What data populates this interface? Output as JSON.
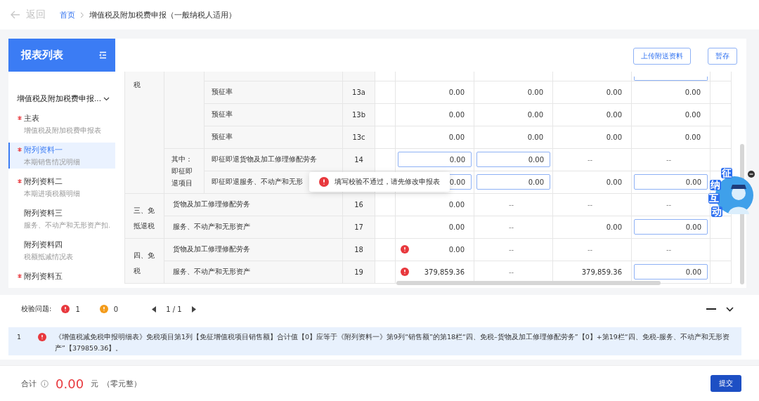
{
  "topbar": {
    "back": "返回",
    "breadcrumb": [
      {
        "label": "首页",
        "kind": "link"
      },
      {
        "label": "增值税及附加税费申报（一般纳税人适用）",
        "kind": "current"
      }
    ]
  },
  "sidebar": {
    "title": "报表列表",
    "group": {
      "label": "增值税及附加税费申报...",
      "expanded": true
    },
    "items": [
      {
        "title": "主表",
        "subtitle": "增值税及附加税费申报表",
        "required": true,
        "selected": false
      },
      {
        "title": "附列资料一",
        "subtitle": "本期销售情况明细",
        "required": true,
        "selected": true
      },
      {
        "title": "附列资料二",
        "subtitle": "本期进项税额明细",
        "required": true,
        "selected": false
      },
      {
        "title": "附列资料三",
        "subtitle": "服务、不动产和无形资产扣.",
        "required": false,
        "selected": false
      },
      {
        "title": "附列资料四",
        "subtitle": "税额抵减情况表",
        "required": false,
        "selected": false
      },
      {
        "title": "附列资料五",
        "required": true,
        "selected": false
      }
    ]
  },
  "actions": [
    "上传附送资料",
    "暂存"
  ],
  "table": {
    "groups": [
      {
        "label": "税",
        "subgroups": [
          {
            "rows": [
              {
                "cells": [
                  {
                    "kind": "blank"
                  },
                  {
                    "kind": "blank"
                  },
                  {
                    "kind": "blank"
                  },
                  {
                    "kind": "input"
                  }
                ]
              },
              {
                "label": "预征率",
                "line": "13a",
                "cells": [
                  {
                    "kind": "text",
                    "value": "0.00"
                  },
                  {
                    "kind": "text",
                    "value": "0.00"
                  },
                  {
                    "kind": "text",
                    "value": "0.00"
                  },
                  {
                    "kind": "text",
                    "value": "0.00"
                  }
                ]
              },
              {
                "label": "预征率",
                "line": "13b",
                "cells": [
                  {
                    "kind": "text",
                    "value": "0.00"
                  },
                  {
                    "kind": "text",
                    "value": "0.00"
                  },
                  {
                    "kind": "text",
                    "value": "0.00"
                  },
                  {
                    "kind": "text",
                    "value": "0.00"
                  }
                ]
              },
              {
                "label": "预征率",
                "line": "13c",
                "cells": [
                  {
                    "kind": "text",
                    "value": "0.00"
                  },
                  {
                    "kind": "text",
                    "value": "0.00"
                  },
                  {
                    "kind": "text",
                    "value": "0.00"
                  },
                  {
                    "kind": "text",
                    "value": "0.00"
                  }
                ]
              }
            ]
          },
          {
            "label": "其中：即征即退项目",
            "rows": [
              {
                "label": "即征即退货物及加工修理修配劳务",
                "line": "14",
                "cells": [
                  {
                    "kind": "input",
                    "value": "0.00"
                  },
                  {
                    "kind": "input",
                    "value": "0.00"
                  },
                  {
                    "kind": "text",
                    "value": "--"
                  },
                  {
                    "kind": "text",
                    "value": "--"
                  }
                ]
              },
              {
                "label": "即征即退服务、不动产和无形",
                "cells": [
                  {
                    "kind": "input",
                    "value": "0.00"
                  },
                  {
                    "kind": "input",
                    "value": "0.00"
                  },
                  {
                    "kind": "text",
                    "value": "0.00"
                  },
                  {
                    "kind": "input",
                    "value": "0.00"
                  }
                ]
              }
            ]
          }
        ]
      },
      {
        "label": "三、免抵退税",
        "rows": [
          {
            "label": "货物及加工修理修配劳务",
            "line": "16",
            "cells": [
              {
                "kind": "text",
                "value": "0.00"
              },
              {
                "kind": "text",
                "value": "--"
              },
              {
                "kind": "text",
                "value": "--"
              },
              {
                "kind": "text",
                "value": "--"
              }
            ]
          },
          {
            "label": "服务、不动产和无形资产",
            "line": "17",
            "cells": [
              {
                "kind": "text",
                "value": "0.00"
              },
              {
                "kind": "text",
                "value": "--"
              },
              {
                "kind": "text",
                "value": "0.00"
              },
              {
                "kind": "input",
                "value": "0.00"
              }
            ]
          }
        ]
      },
      {
        "label": "四、免税",
        "rows": [
          {
            "label": "货物及加工修理修配劳务",
            "line": "18",
            "cells": [
              {
                "kind": "text",
                "value": "0.00",
                "error": true
              },
              {
                "kind": "text",
                "value": "--"
              },
              {
                "kind": "text",
                "value": "--"
              },
              {
                "kind": "text",
                "value": "--"
              }
            ]
          },
          {
            "label": "服务、不动产和无形资产",
            "line": "19",
            "cells": [
              {
                "kind": "text",
                "value": "379,859.36",
                "error": true
              },
              {
                "kind": "text",
                "value": "--"
              },
              {
                "kind": "text",
                "value": "379,859.36"
              },
              {
                "kind": "input",
                "value": "0.00"
              }
            ]
          }
        ]
      }
    ]
  },
  "toast": "填写校验不通过，请先修改申报表",
  "assistant": {
    "label": [
      "征",
      "纳",
      "互",
      "动"
    ]
  },
  "validation": {
    "label": "校验问题:",
    "errors": "1",
    "warnings": "0",
    "page": "1 / 1",
    "expanded": true,
    "messages": [
      {
        "index": "1",
        "text": "《增值税减免税申报明细表》免税项目第1列【免征增值税项目销售额】合计值【0】应等于《附列资料一》第9列“销售额”的第18栏“四、免税–货物及加工修理修配劳务”【0】+第19栏“四、免税–服务、不动产和无形资产”【379859.36】。"
      }
    ]
  },
  "footer": {
    "label": "合计",
    "amount": "0.00",
    "unit": "元",
    "words": "（零元整）",
    "submit": "提交"
  }
}
